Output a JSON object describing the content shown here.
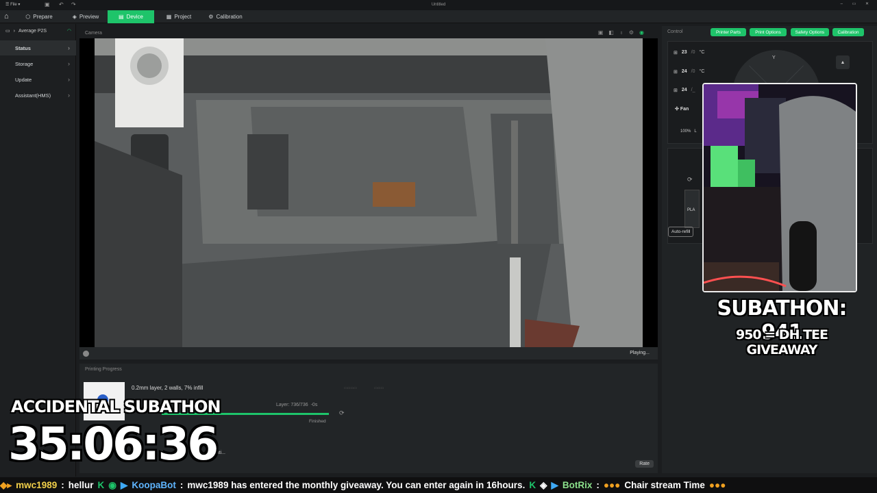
{
  "window": {
    "title": "Untitled",
    "file_menu": "File"
  },
  "nav": {
    "tabs": [
      {
        "label": "Prepare"
      },
      {
        "label": "Preview"
      },
      {
        "label": "Device"
      },
      {
        "label": "Project"
      },
      {
        "label": "Calibration"
      }
    ],
    "active_tab": "Device"
  },
  "sidebar": {
    "printer": "Average P2S",
    "items": [
      {
        "label": "Status"
      },
      {
        "label": "Storage"
      },
      {
        "label": "Update"
      },
      {
        "label": "Assistant(HMS)"
      }
    ]
  },
  "camera": {
    "header": "Camera",
    "status": "Playing..."
  },
  "progress": {
    "header": "Printing Progress",
    "description": "0.2mm layer, 2 walls, 7% infill",
    "layer": "Layer: 736/736",
    "eta": "-0s",
    "state": "Finished",
    "sub": "is printi...",
    "rate_button": "Rate",
    "percent": 100
  },
  "control": {
    "header": "Control",
    "buttons": [
      "Printer Parts",
      "Print Options",
      "Safety Options",
      "Calibration"
    ],
    "temps": [
      {
        "value": "23",
        "target": "/0",
        "unit": "°C"
      },
      {
        "value": "24",
        "target": "/0",
        "unit": "°C"
      },
      {
        "value": "24",
        "target": "/_",
        "unit": ""
      }
    ],
    "dial_label": "Y",
    "fan_label": "Fan",
    "speed_label": "100%",
    "speed_suffix": "L",
    "ams_slot_label": "PLA",
    "auto_refill": "Auto-refill"
  },
  "overlay": {
    "subathon": "SUBATHON: 941",
    "giveaway": "950 = DH TEE GIVEAWAY",
    "accidental": "ACCIDENTAL SUBATHON",
    "timer": "35:06:36"
  },
  "ticker": {
    "user1": "mwc1989",
    "msg1": "hellur",
    "bot": "KoopaBot",
    "bot_msg": "mwc1989 has entered the monthly giveaway. You can enter again in 16hours.",
    "bot2": "BotRix",
    "bot2_msg": "Chair stream Time"
  },
  "colors": {
    "accent": "#1ec46a",
    "background": "#1b1d1f"
  }
}
